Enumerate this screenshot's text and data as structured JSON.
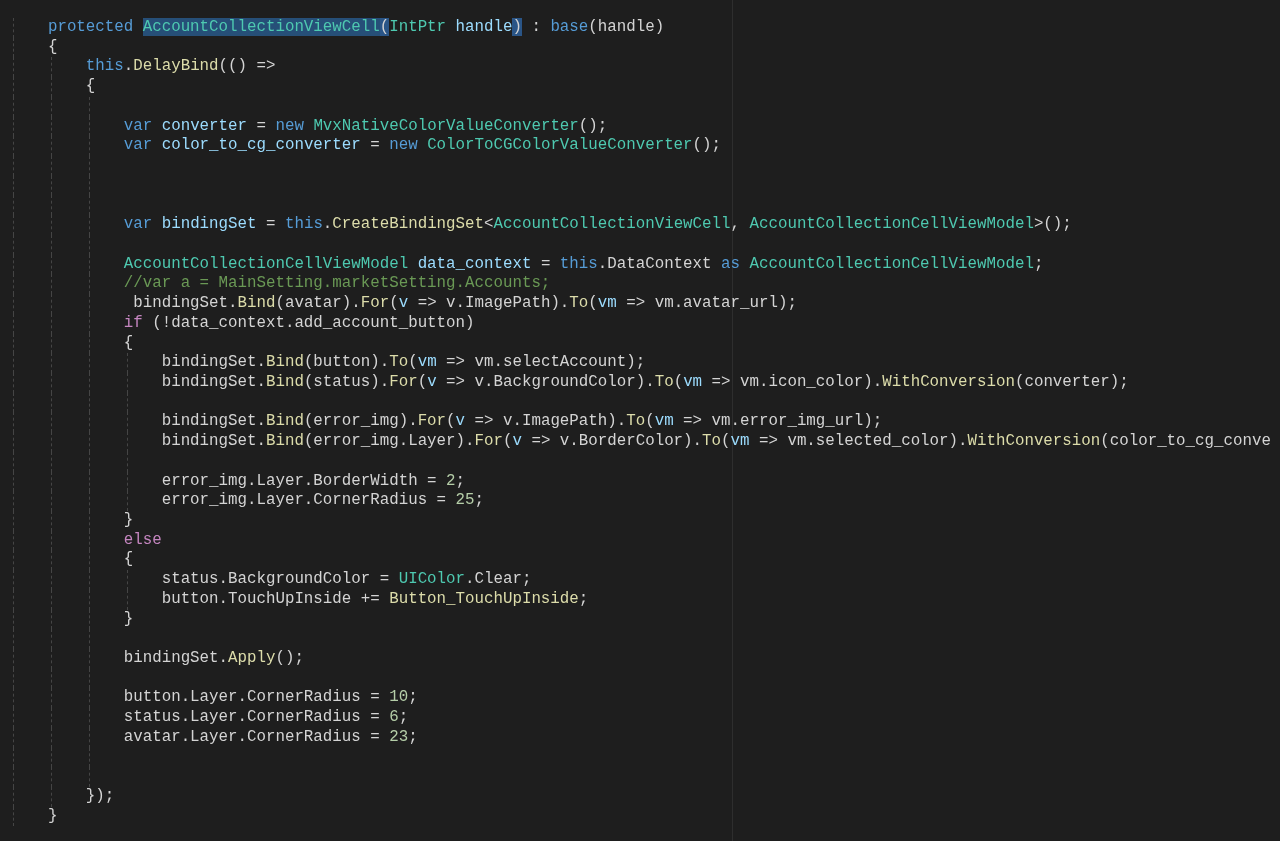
{
  "editor": {
    "lines": [
      {
        "kind": "code",
        "tokens": [
          {
            "kind": "keyword",
            "text": "    protected "
          },
          {
            "kind": "selection",
            "text": "AccountCollectionViewCell"
          },
          {
            "kind": "bracket",
            "text": "("
          },
          {
            "kind": "type",
            "text": "IntPtr "
          },
          {
            "kind": "variable",
            "text": "handle"
          },
          {
            "kind": "bracket",
            "text": ")"
          },
          {
            "kind": "plain",
            "text": " : "
          },
          {
            "kind": "keyword",
            "text": "base"
          },
          {
            "kind": "plain",
            "text": "(handle)"
          }
        ]
      },
      {
        "kind": "code",
        "tokens": [
          {
            "kind": "plain",
            "text": "    {"
          }
        ]
      },
      {
        "kind": "code",
        "tokens": [
          {
            "kind": "keyword",
            "text": "        this"
          },
          {
            "kind": "plain",
            "text": "."
          },
          {
            "kind": "method",
            "text": "DelayBind"
          },
          {
            "kind": "plain",
            "text": "(() =>"
          }
        ]
      },
      {
        "kind": "code",
        "tokens": [
          {
            "kind": "plain",
            "text": "        {"
          }
        ]
      },
      {
        "kind": "blank"
      },
      {
        "kind": "code",
        "tokens": [
          {
            "kind": "keyword",
            "text": "            var "
          },
          {
            "kind": "variable",
            "text": "converter"
          },
          {
            "kind": "plain",
            "text": " = "
          },
          {
            "kind": "keyword",
            "text": "new "
          },
          {
            "kind": "type",
            "text": "MvxNativeColorValueConverter"
          },
          {
            "kind": "plain",
            "text": "();"
          }
        ]
      },
      {
        "kind": "code",
        "tokens": [
          {
            "kind": "keyword",
            "text": "            var "
          },
          {
            "kind": "variable",
            "text": "color_to_cg_converter"
          },
          {
            "kind": "plain",
            "text": " = "
          },
          {
            "kind": "keyword",
            "text": "new "
          },
          {
            "kind": "type",
            "text": "ColorToCGColorValueConverter"
          },
          {
            "kind": "plain",
            "text": "();"
          }
        ]
      },
      {
        "kind": "blank"
      },
      {
        "kind": "blank"
      },
      {
        "kind": "blank"
      },
      {
        "kind": "code",
        "tokens": [
          {
            "kind": "keyword",
            "text": "            var "
          },
          {
            "kind": "variable",
            "text": "bindingSet"
          },
          {
            "kind": "plain",
            "text": " = "
          },
          {
            "kind": "keyword",
            "text": "this"
          },
          {
            "kind": "plain",
            "text": "."
          },
          {
            "kind": "method",
            "text": "CreateBindingSet"
          },
          {
            "kind": "plain",
            "text": "<"
          },
          {
            "kind": "type",
            "text": "AccountCollectionViewCell"
          },
          {
            "kind": "plain",
            "text": ", "
          },
          {
            "kind": "type",
            "text": "AccountCollectionCellViewModel"
          },
          {
            "kind": "plain",
            "text": ">();"
          }
        ]
      },
      {
        "kind": "blank"
      },
      {
        "kind": "code",
        "tokens": [
          {
            "kind": "type",
            "text": "            AccountCollectionCellViewModel "
          },
          {
            "kind": "variable",
            "text": "data_context"
          },
          {
            "kind": "plain",
            "text": " = "
          },
          {
            "kind": "keyword",
            "text": "this"
          },
          {
            "kind": "plain",
            "text": ".DataContext "
          },
          {
            "kind": "keyword",
            "text": "as "
          },
          {
            "kind": "type",
            "text": "AccountCollectionCellViewModel"
          },
          {
            "kind": "plain",
            "text": ";"
          }
        ]
      },
      {
        "kind": "code",
        "tokens": [
          {
            "kind": "comment",
            "text": "            //var a = MainSetting.marketSetting.Accounts;"
          }
        ]
      },
      {
        "kind": "code",
        "tokens": [
          {
            "kind": "plain",
            "text": "             bindingSet."
          },
          {
            "kind": "method",
            "text": "Bind"
          },
          {
            "kind": "plain",
            "text": "(avatar)."
          },
          {
            "kind": "method",
            "text": "For"
          },
          {
            "kind": "plain",
            "text": "("
          },
          {
            "kind": "variable",
            "text": "v"
          },
          {
            "kind": "plain",
            "text": " => v.ImagePath)."
          },
          {
            "kind": "method",
            "text": "To"
          },
          {
            "kind": "plain",
            "text": "("
          },
          {
            "kind": "variable",
            "text": "vm"
          },
          {
            "kind": "plain",
            "text": " => vm.avatar_url);"
          }
        ]
      },
      {
        "kind": "code",
        "tokens": [
          {
            "kind": "control",
            "text": "            if"
          },
          {
            "kind": "plain",
            "text": " (!data_context.add_account_button)"
          }
        ]
      },
      {
        "kind": "code",
        "tokens": [
          {
            "kind": "plain",
            "text": "            {"
          }
        ]
      },
      {
        "kind": "code",
        "tokens": [
          {
            "kind": "plain",
            "text": "                bindingSet."
          },
          {
            "kind": "method",
            "text": "Bind"
          },
          {
            "kind": "plain",
            "text": "(button)."
          },
          {
            "kind": "method",
            "text": "To"
          },
          {
            "kind": "plain",
            "text": "("
          },
          {
            "kind": "variable",
            "text": "vm"
          },
          {
            "kind": "plain",
            "text": " => vm.selectAccount);"
          }
        ]
      },
      {
        "kind": "code",
        "tokens": [
          {
            "kind": "plain",
            "text": "                bindingSet."
          },
          {
            "kind": "method",
            "text": "Bind"
          },
          {
            "kind": "plain",
            "text": "(status)."
          },
          {
            "kind": "method",
            "text": "For"
          },
          {
            "kind": "plain",
            "text": "("
          },
          {
            "kind": "variable",
            "text": "v"
          },
          {
            "kind": "plain",
            "text": " => v.BackgroundColor)."
          },
          {
            "kind": "method",
            "text": "To"
          },
          {
            "kind": "plain",
            "text": "("
          },
          {
            "kind": "variable",
            "text": "vm"
          },
          {
            "kind": "plain",
            "text": " => vm.icon_color)."
          },
          {
            "kind": "method",
            "text": "WithConversion"
          },
          {
            "kind": "plain",
            "text": "(converter);"
          }
        ]
      },
      {
        "kind": "blank"
      },
      {
        "kind": "code",
        "tokens": [
          {
            "kind": "plain",
            "text": "                bindingSet."
          },
          {
            "kind": "method",
            "text": "Bind"
          },
          {
            "kind": "plain",
            "text": "(error_img)."
          },
          {
            "kind": "method",
            "text": "For"
          },
          {
            "kind": "plain",
            "text": "("
          },
          {
            "kind": "variable",
            "text": "v"
          },
          {
            "kind": "plain",
            "text": " => v.ImagePath)."
          },
          {
            "kind": "method",
            "text": "To"
          },
          {
            "kind": "plain",
            "text": "("
          },
          {
            "kind": "variable",
            "text": "vm"
          },
          {
            "kind": "plain",
            "text": " => vm.error_img_url);"
          }
        ]
      },
      {
        "kind": "code",
        "tokens": [
          {
            "kind": "plain",
            "text": "                bindingSet."
          },
          {
            "kind": "method",
            "text": "Bind"
          },
          {
            "kind": "plain",
            "text": "(error_img.Layer)."
          },
          {
            "kind": "method",
            "text": "For"
          },
          {
            "kind": "plain",
            "text": "("
          },
          {
            "kind": "variable",
            "text": "v"
          },
          {
            "kind": "plain",
            "text": " => v.BorderColor)."
          },
          {
            "kind": "method",
            "text": "To"
          },
          {
            "kind": "plain",
            "text": "("
          },
          {
            "kind": "variable",
            "text": "vm"
          },
          {
            "kind": "plain",
            "text": " => vm.selected_color)."
          },
          {
            "kind": "method",
            "text": "WithConversion"
          },
          {
            "kind": "plain",
            "text": "(color_to_cg_conve"
          }
        ]
      },
      {
        "kind": "blank"
      },
      {
        "kind": "code",
        "tokens": [
          {
            "kind": "plain",
            "text": "                error_img.Layer.BorderWidth = "
          },
          {
            "kind": "number",
            "text": "2"
          },
          {
            "kind": "plain",
            "text": ";"
          }
        ]
      },
      {
        "kind": "code",
        "tokens": [
          {
            "kind": "plain",
            "text": "                error_img.Layer.CornerRadius = "
          },
          {
            "kind": "number",
            "text": "25"
          },
          {
            "kind": "plain",
            "text": ";"
          }
        ]
      },
      {
        "kind": "code",
        "tokens": [
          {
            "kind": "plain",
            "text": "            }"
          }
        ]
      },
      {
        "kind": "code",
        "tokens": [
          {
            "kind": "control",
            "text": "            else"
          }
        ]
      },
      {
        "kind": "code",
        "tokens": [
          {
            "kind": "plain",
            "text": "            {"
          }
        ]
      },
      {
        "kind": "code",
        "tokens": [
          {
            "kind": "plain",
            "text": "                status.BackgroundColor = "
          },
          {
            "kind": "type",
            "text": "UIColor"
          },
          {
            "kind": "plain",
            "text": ".Clear;"
          }
        ]
      },
      {
        "kind": "code",
        "tokens": [
          {
            "kind": "plain",
            "text": "                button.TouchUpInside += "
          },
          {
            "kind": "method",
            "text": "Button_TouchUpInside"
          },
          {
            "kind": "plain",
            "text": ";"
          }
        ]
      },
      {
        "kind": "code",
        "tokens": [
          {
            "kind": "plain",
            "text": "            }"
          }
        ]
      },
      {
        "kind": "blank"
      },
      {
        "kind": "code",
        "tokens": [
          {
            "kind": "plain",
            "text": "            bindingSet."
          },
          {
            "kind": "method",
            "text": "Apply"
          },
          {
            "kind": "plain",
            "text": "();"
          }
        ]
      },
      {
        "kind": "blank"
      },
      {
        "kind": "code",
        "tokens": [
          {
            "kind": "plain",
            "text": "            button.Layer.CornerRadius = "
          },
          {
            "kind": "number",
            "text": "10"
          },
          {
            "kind": "plain",
            "text": ";"
          }
        ]
      },
      {
        "kind": "code",
        "tokens": [
          {
            "kind": "plain",
            "text": "            status.Layer.CornerRadius = "
          },
          {
            "kind": "number",
            "text": "6"
          },
          {
            "kind": "plain",
            "text": ";"
          }
        ]
      },
      {
        "kind": "code",
        "tokens": [
          {
            "kind": "plain",
            "text": "            avatar.Layer.CornerRadius = "
          },
          {
            "kind": "number",
            "text": "23"
          },
          {
            "kind": "plain",
            "text": ";"
          }
        ]
      },
      {
        "kind": "blank"
      },
      {
        "kind": "blank"
      },
      {
        "kind": "code",
        "tokens": [
          {
            "kind": "plain",
            "text": "        });"
          }
        ]
      },
      {
        "kind": "code",
        "tokens": [
          {
            "kind": "plain",
            "text": "    }"
          }
        ]
      }
    ]
  }
}
